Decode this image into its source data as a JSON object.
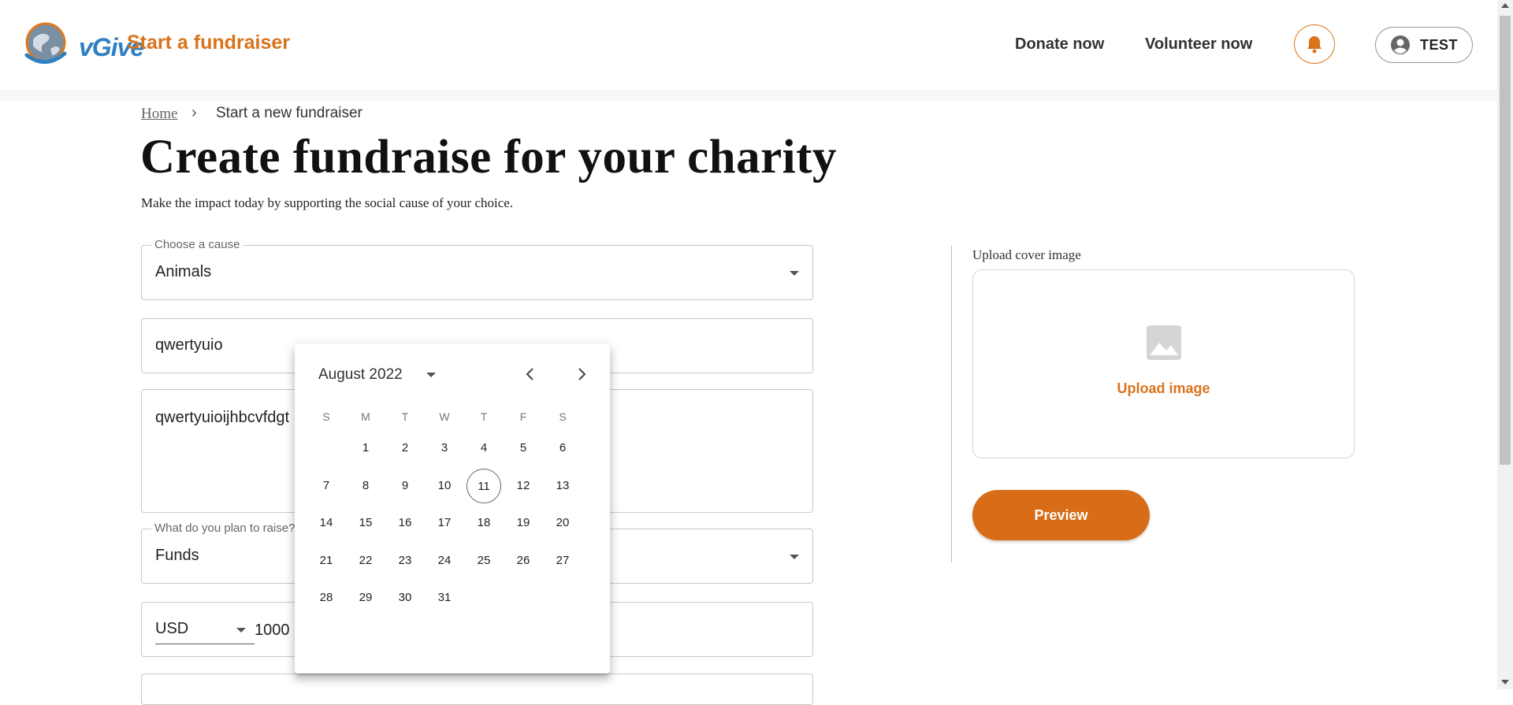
{
  "header": {
    "logo_text": "vGive",
    "brand_title": "Start a fundraiser",
    "nav": {
      "donate": "Donate now",
      "volunteer": "Volunteer now"
    },
    "user_label": "TEST",
    "icons": [
      "bell-icon",
      "account-circle-icon"
    ]
  },
  "breadcrumb": {
    "home": "Home",
    "separator": "›",
    "current": "Start a new fundraiser"
  },
  "page": {
    "title": "Create fundraise for your charity",
    "subtitle": "Make the impact today by supporting the social cause of your choice."
  },
  "form": {
    "cause": {
      "label": "Choose a cause",
      "value": "Animals"
    },
    "name": {
      "value": "qwertyuio"
    },
    "description": {
      "value": "qwertyuioijhbcvfdgt"
    },
    "raise_type": {
      "label": "What do you plan to raise?",
      "value": "Funds"
    },
    "amount": {
      "currency": "USD",
      "value": "1000"
    }
  },
  "upload": {
    "label": "Upload cover image",
    "button": "Upload image"
  },
  "preview_button": "Preview",
  "datepicker": {
    "month_label": "August 2022",
    "weekdays": [
      "S",
      "M",
      "T",
      "W",
      "T",
      "F",
      "S"
    ],
    "first_weekday_index": 1,
    "days_in_month": 31,
    "today": 11
  },
  "colors": {
    "accent": "#d9731c",
    "logo_blue": "#2f7fc1"
  }
}
